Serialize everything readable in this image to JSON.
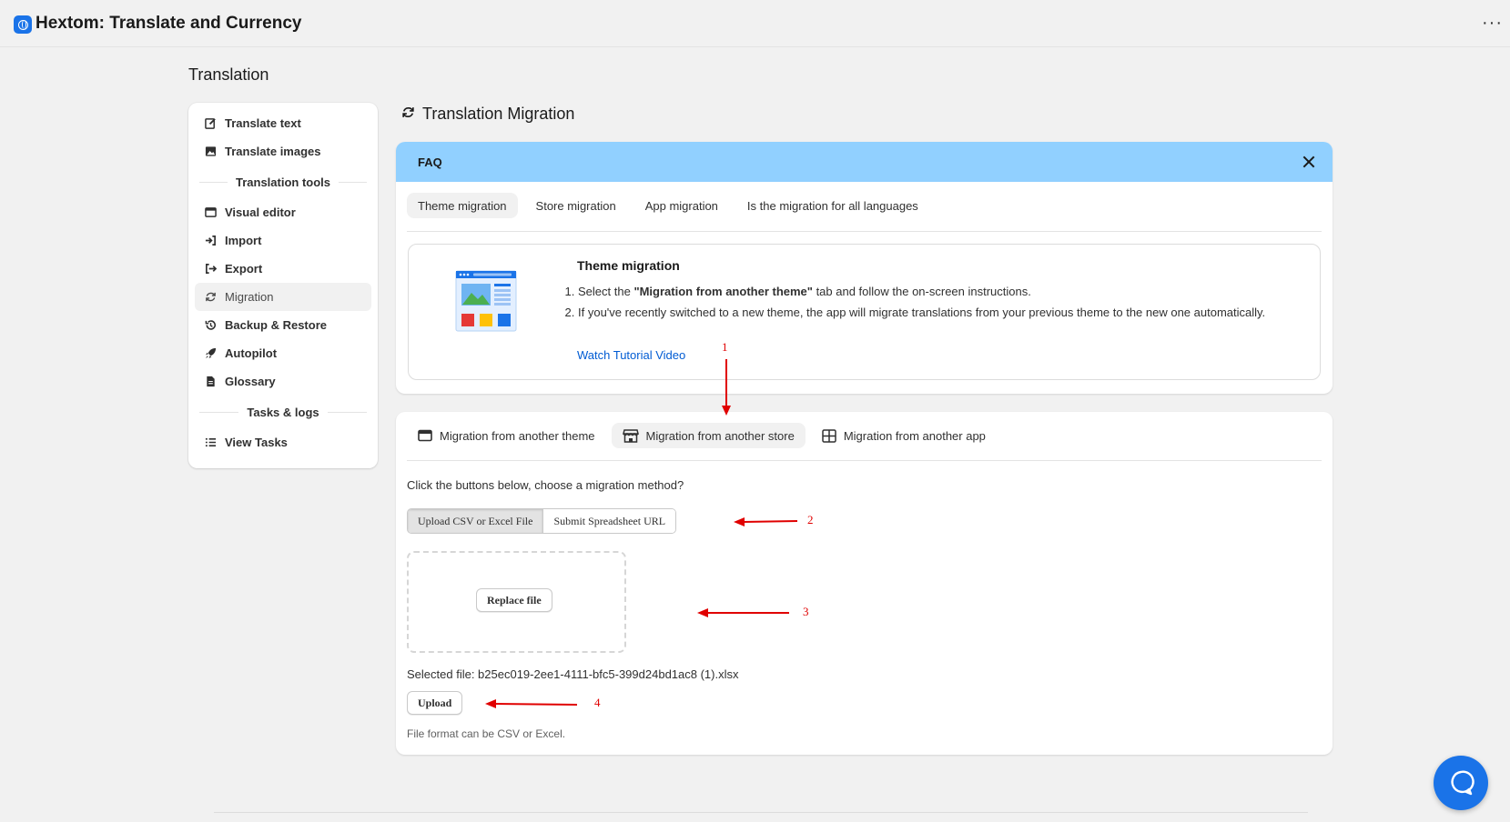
{
  "app": {
    "title": "Hextom: Translate and Currency",
    "more_label": "···"
  },
  "page": {
    "title": "Translation"
  },
  "sidebar": {
    "items": [
      {
        "label": "Translate text",
        "icon": "edit-icon"
      },
      {
        "label": "Translate images",
        "icon": "image-icon"
      }
    ],
    "group1": "Translation tools",
    "tools": [
      {
        "label": "Visual editor",
        "icon": "window-icon"
      },
      {
        "label": "Import",
        "icon": "import-icon"
      },
      {
        "label": "Export",
        "icon": "export-icon"
      },
      {
        "label": "Migration",
        "icon": "refresh-icon",
        "active": true
      },
      {
        "label": "Backup & Restore",
        "icon": "history-icon"
      },
      {
        "label": "Autopilot",
        "icon": "rocket-icon"
      },
      {
        "label": "Glossary",
        "icon": "document-icon"
      }
    ],
    "group2": "Tasks & logs",
    "tasks": [
      {
        "label": "View Tasks",
        "icon": "list-icon"
      }
    ]
  },
  "section": {
    "title": "Translation Migration"
  },
  "faq": {
    "header": "FAQ",
    "tabs": [
      "Theme migration",
      "Store migration",
      "App migration",
      "Is the migration for all languages"
    ],
    "content": {
      "title": "Theme migration",
      "step1_prefix": "Select the ",
      "step1_bold": "\"Migration from another theme\"",
      "step1_suffix": " tab and follow the on-screen instructions.",
      "step2": "If you've recently switched to a new theme, the app will migrate translations from your previous theme to the new one automatically.",
      "link": "Watch Tutorial Video"
    }
  },
  "migration": {
    "tabs": [
      {
        "label": "Migration from another theme",
        "icon": "window-icon"
      },
      {
        "label": "Migration from another store",
        "icon": "store-icon",
        "active": true
      },
      {
        "label": "Migration from another app",
        "icon": "apps-icon"
      }
    ],
    "prompt": "Click the buttons below, choose a migration method?",
    "methods": [
      "Upload CSV or Excel File",
      "Submit Spreadsheet URL"
    ],
    "replace_label": "Replace file",
    "selected_file": "Selected file: b25ec019-2ee1-4111-bfc5-399d24bd1ac8 (1).xlsx",
    "upload_label": "Upload",
    "hint": "File format can be CSV or Excel."
  },
  "annotations": [
    "1",
    "2",
    "3",
    "4"
  ],
  "colors": {
    "faq_header": "#91d0ff",
    "link": "#005bd3",
    "accent": "#1a73e8",
    "annotation": "#e00000"
  }
}
